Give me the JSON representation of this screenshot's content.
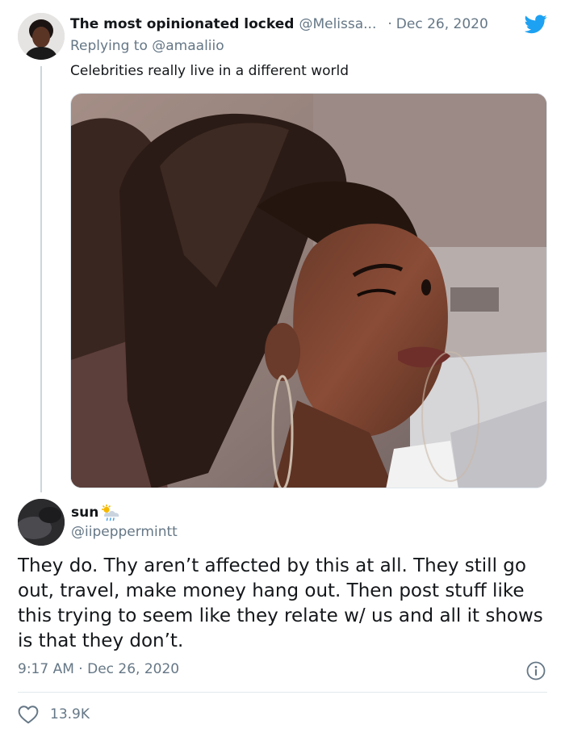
{
  "reply_tweet": {
    "display_name": "The most opinionated locked",
    "handle": "@Melissa...",
    "separator": "·",
    "date": "Dec 26, 2020",
    "replying_prefix": "Replying to",
    "replying_to": "@amaaliio",
    "text": "Celebrities really live in a different world",
    "icons": {
      "brand": "twitter-bird-icon"
    }
  },
  "main_tweet": {
    "display_name": "sun",
    "handle": "@iipeppermintt",
    "text": "They do. Thy aren’t affected by this at all. They still go out, travel, make money hang out. Then post stuff like this trying to seem like they relate w/ us and all it shows is that they don’t.",
    "time": "9:17 AM",
    "separator": "·",
    "date": "Dec 26, 2020",
    "like_count": "13.9K",
    "icons": {
      "name_emoji": "sun-behind-rain-cloud-icon",
      "info": "info-icon",
      "like": "heart-icon"
    }
  },
  "colors": {
    "text_primary": "#14171a",
    "text_secondary": "#657786",
    "twitter_blue": "#1da1f2",
    "divider": "#e1e8ed"
  }
}
